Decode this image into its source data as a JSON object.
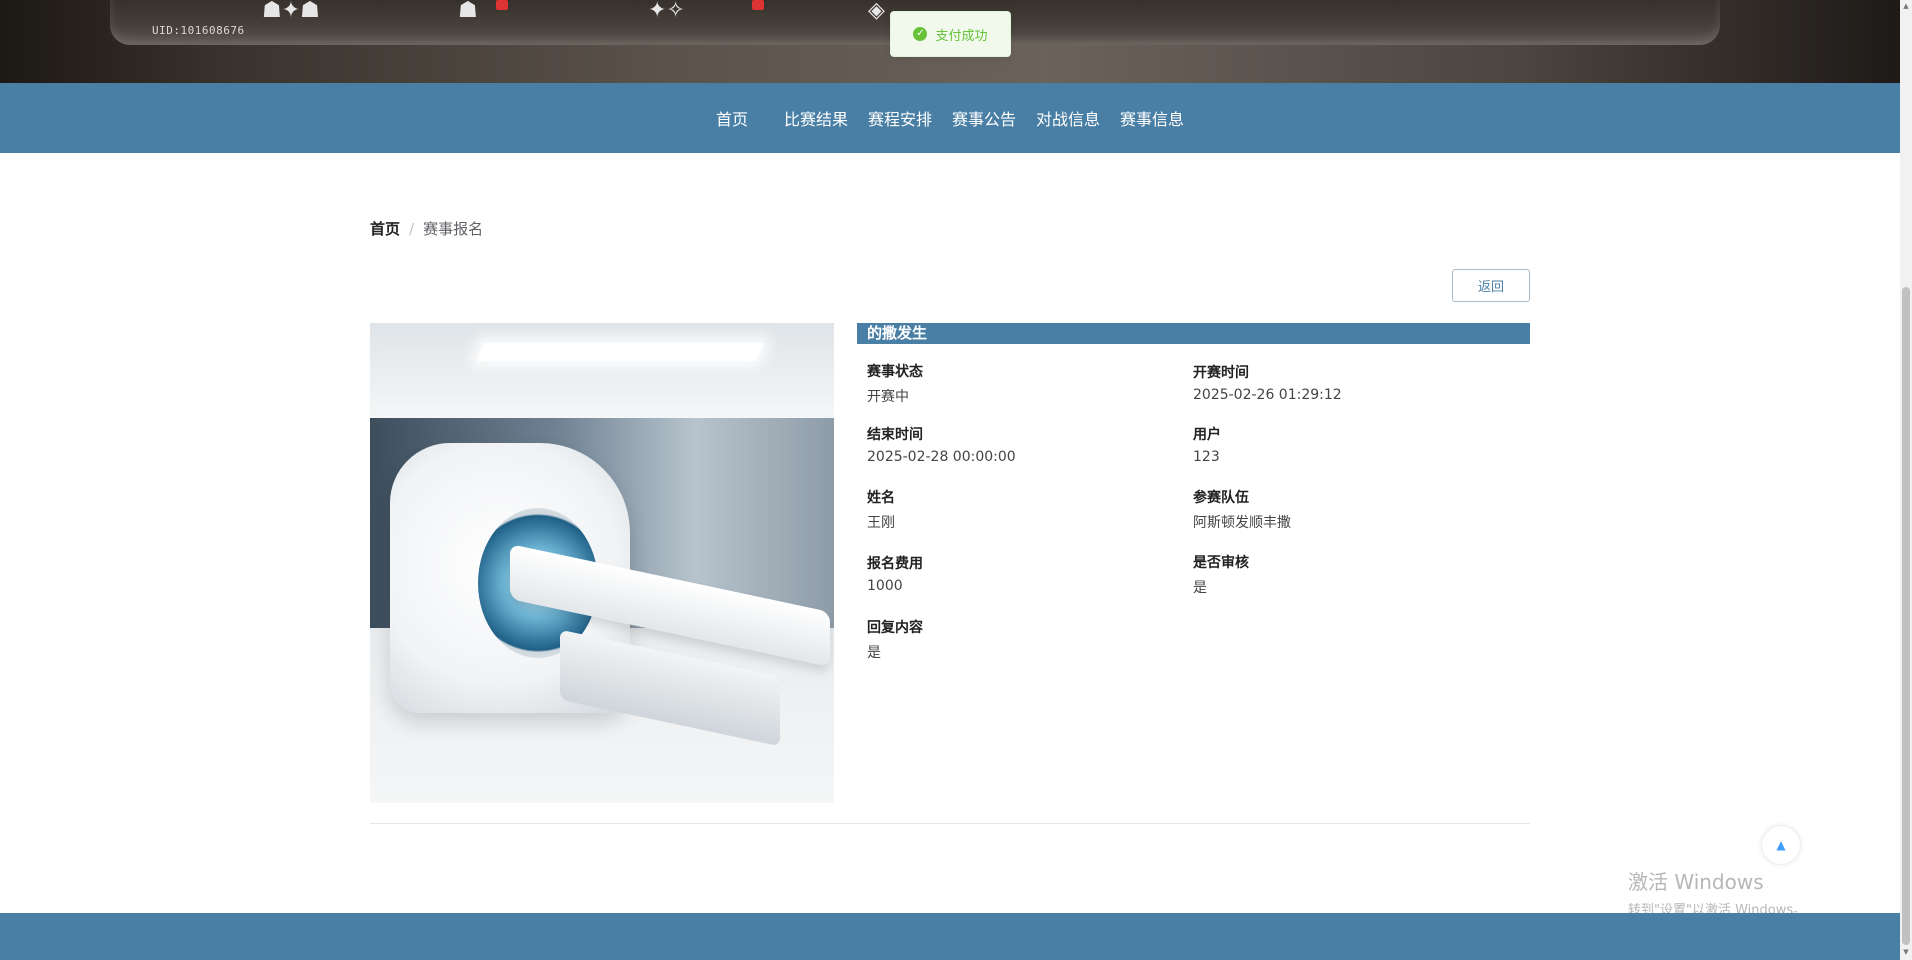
{
  "banner": {
    "uid_text": "UID:101608676"
  },
  "toast": {
    "message": "支付成功",
    "icon": "check-circle-icon",
    "color": "#67c23a"
  },
  "nav": {
    "items": [
      {
        "label": "首页"
      },
      {
        "label": "比赛结果"
      },
      {
        "label": "赛程安排"
      },
      {
        "label": "赛事公告"
      },
      {
        "label": "对战信息"
      },
      {
        "label": "赛事信息"
      }
    ]
  },
  "breadcrumb": {
    "home": "首页",
    "separator": "/",
    "current": "赛事报名"
  },
  "actions": {
    "back_label": "返回"
  },
  "detail": {
    "title": "的撒发生",
    "fields": {
      "status": {
        "label": "赛事状态",
        "value": "开赛中"
      },
      "start_time": {
        "label": "开赛时间",
        "value": "2025-02-26 01:29:12"
      },
      "end_time": {
        "label": "结束时间",
        "value": "2025-02-28 00:00:00"
      },
      "user": {
        "label": "用户",
        "value": "123"
      },
      "name": {
        "label": "姓名",
        "value": "王刚"
      },
      "team": {
        "label": "参赛队伍",
        "value": "阿斯顿发顺丰撒"
      },
      "fee": {
        "label": "报名费用",
        "value": "1000"
      },
      "reviewed": {
        "label": "是否审核",
        "value": "是"
      },
      "reply": {
        "label": "回复内容",
        "value": "是"
      }
    }
  },
  "watermark": {
    "title": "激活 Windows",
    "subtitle": "转到\"设置\"以激活 Windows。"
  },
  "theme": {
    "primary": "#4a7fa5"
  }
}
